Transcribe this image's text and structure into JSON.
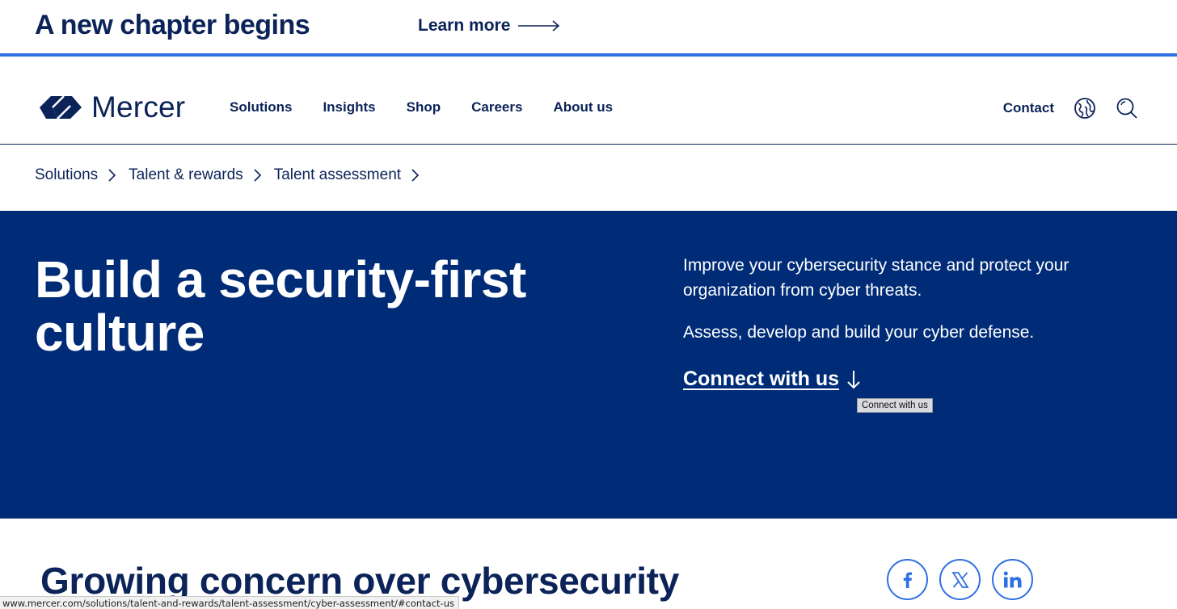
{
  "announcement": {
    "title": "A new chapter begins",
    "link_label": "Learn more"
  },
  "brand": {
    "name": "Mercer",
    "logo_icon": "mercer-logo-icon"
  },
  "nav": {
    "items": [
      {
        "label": "Solutions"
      },
      {
        "label": "Insights"
      },
      {
        "label": "Shop"
      },
      {
        "label": "Careers"
      },
      {
        "label": "About us"
      }
    ],
    "contact_label": "Contact",
    "globe_icon": "globe-icon",
    "search_icon": "search-icon"
  },
  "breadcrumb": [
    {
      "label": "Solutions"
    },
    {
      "label": "Talent & rewards"
    },
    {
      "label": "Talent assessment"
    }
  ],
  "hero": {
    "title": "Build a security-first culture",
    "description": "Improve your cybersecurity stance and protect your organization from cyber threats.",
    "description2": "Assess, develop and build your cyber defense.",
    "cta_label": "Connect with us",
    "tooltip": "Connect with us"
  },
  "section": {
    "title": "Growing concern over cybersecurity"
  },
  "share": {
    "icons": [
      "facebook-icon",
      "x-icon",
      "linkedin-icon"
    ]
  },
  "status_url": "www.mercer.com/solutions/talent-and-rewards/talent-assessment/cyber-assessment/#contact-us",
  "colors": {
    "brand_navy": "#002c77",
    "text_navy": "#0b2358",
    "accent_blue": "#2f6fe4"
  }
}
